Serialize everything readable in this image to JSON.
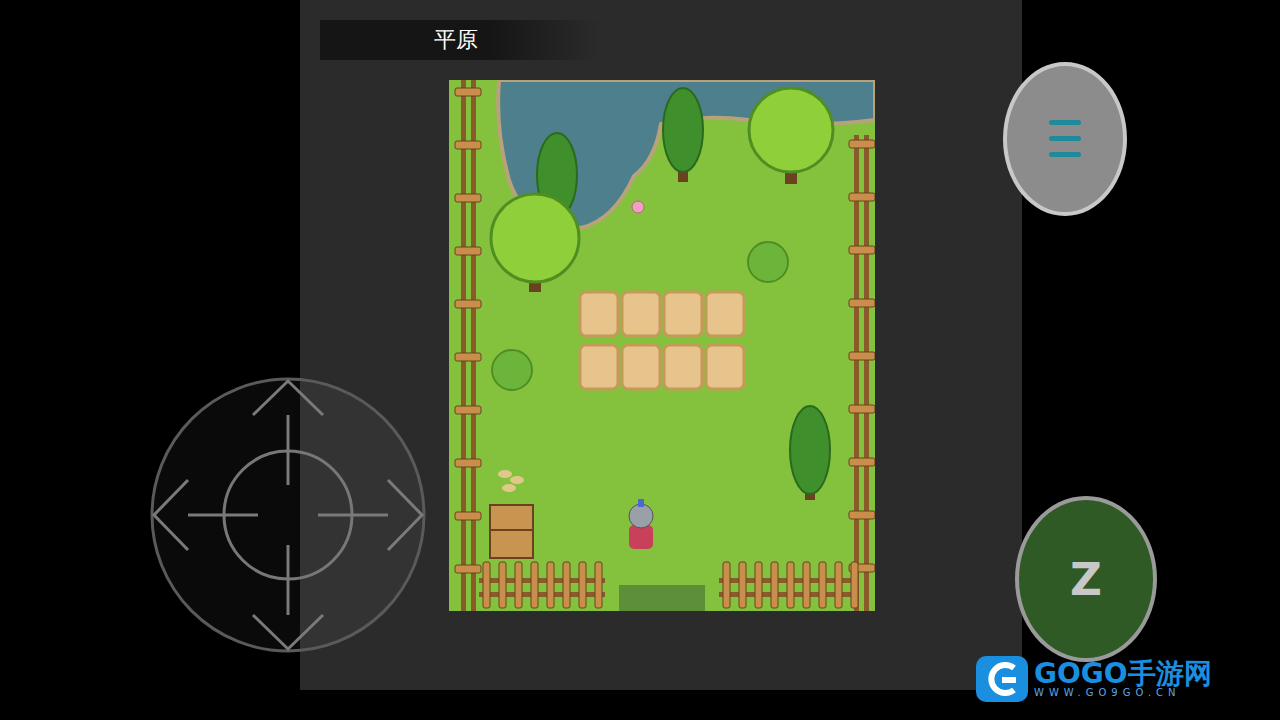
{
  "map": {
    "name": "平原"
  },
  "controls": {
    "action_button": {
      "label": "Z"
    }
  },
  "watermark": {
    "brand": "GOGO手游网",
    "url": "WWW.GO9GO.CN"
  }
}
